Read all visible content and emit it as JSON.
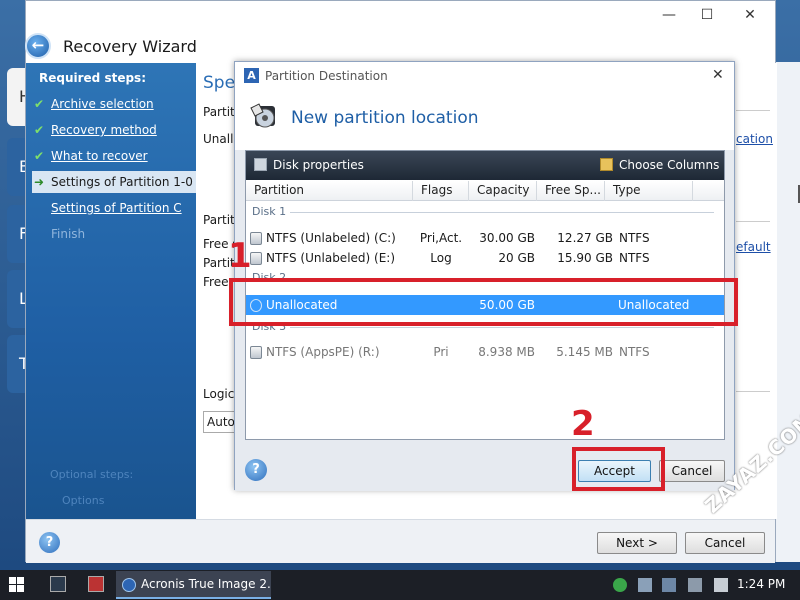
{
  "background_app": {
    "tiles": [
      "H",
      "B",
      "F",
      "L",
      "T"
    ]
  },
  "wizard": {
    "title": "Recovery Wizard",
    "controls": {
      "minimize": "—",
      "maximize": "☐",
      "close": "✕"
    },
    "sidebar": {
      "header": "Required steps:",
      "steps": [
        {
          "label": "Archive selection",
          "done": true
        },
        {
          "label": "Recovery method",
          "done": true
        },
        {
          "label": "What to recover",
          "done": true
        },
        {
          "label": "Settings of Partition 1-0",
          "current": true
        },
        {
          "label": "Settings of Partition C"
        },
        {
          "label": "Finish"
        }
      ],
      "optional_header": "Optional steps:",
      "optional_item": "Options"
    },
    "main": {
      "heading": "Spec",
      "labels": [
        "Partiti",
        "Unalloc",
        "Partiti",
        "Free s",
        "Partiti",
        "Free",
        "Logica"
      ],
      "auto_value": "Auto",
      "link_location": "cation",
      "link_default": "efault"
    },
    "footer": {
      "help": "?",
      "next": "Next >",
      "cancel": "Cancel"
    }
  },
  "dialog": {
    "caption": "Partition Destination",
    "app_icon": "A",
    "close": "✕",
    "title": "New partition location",
    "toolbar": {
      "disk_properties": "Disk properties",
      "choose_columns": "Choose Columns"
    },
    "columns": [
      "Partition",
      "Flags",
      "Capacity",
      "Free Sp...",
      "Type"
    ],
    "disks": [
      {
        "label": "Disk 1",
        "partitions": [
          {
            "name": "NTFS (Unlabeled) (C:)",
            "flags": "Pri,Act.",
            "capacity": "30.00 GB",
            "free": "12.27 GB",
            "type": "NTFS"
          },
          {
            "name": "NTFS (Unlabeled) (E:)",
            "flags": "Log",
            "capacity": "20 GB",
            "free": "15.90 GB",
            "type": "NTFS"
          }
        ]
      },
      {
        "label": "Disk 2",
        "partitions": [
          {
            "name": "Unallocated",
            "flags": "",
            "capacity": "50.00 GB",
            "free": "",
            "type": "Unallocated",
            "selected": true
          }
        ]
      },
      {
        "label": "Disk 3",
        "partitions": [
          {
            "name": "NTFS (AppsPE) (R:)",
            "flags": "Pri",
            "capacity": "8.938 MB",
            "free": "5.145 MB",
            "type": "NTFS"
          }
        ]
      }
    ],
    "footer": {
      "help": "?",
      "accept": "Accept",
      "cancel": "Cancel"
    }
  },
  "annotations": {
    "step1": "1",
    "step2": "2",
    "color": "#d8202a"
  },
  "watermark": "ZAYAZ.COM",
  "taskbar": {
    "app_label": "Acronis True Image 2...",
    "clock": "1:24 PM"
  }
}
